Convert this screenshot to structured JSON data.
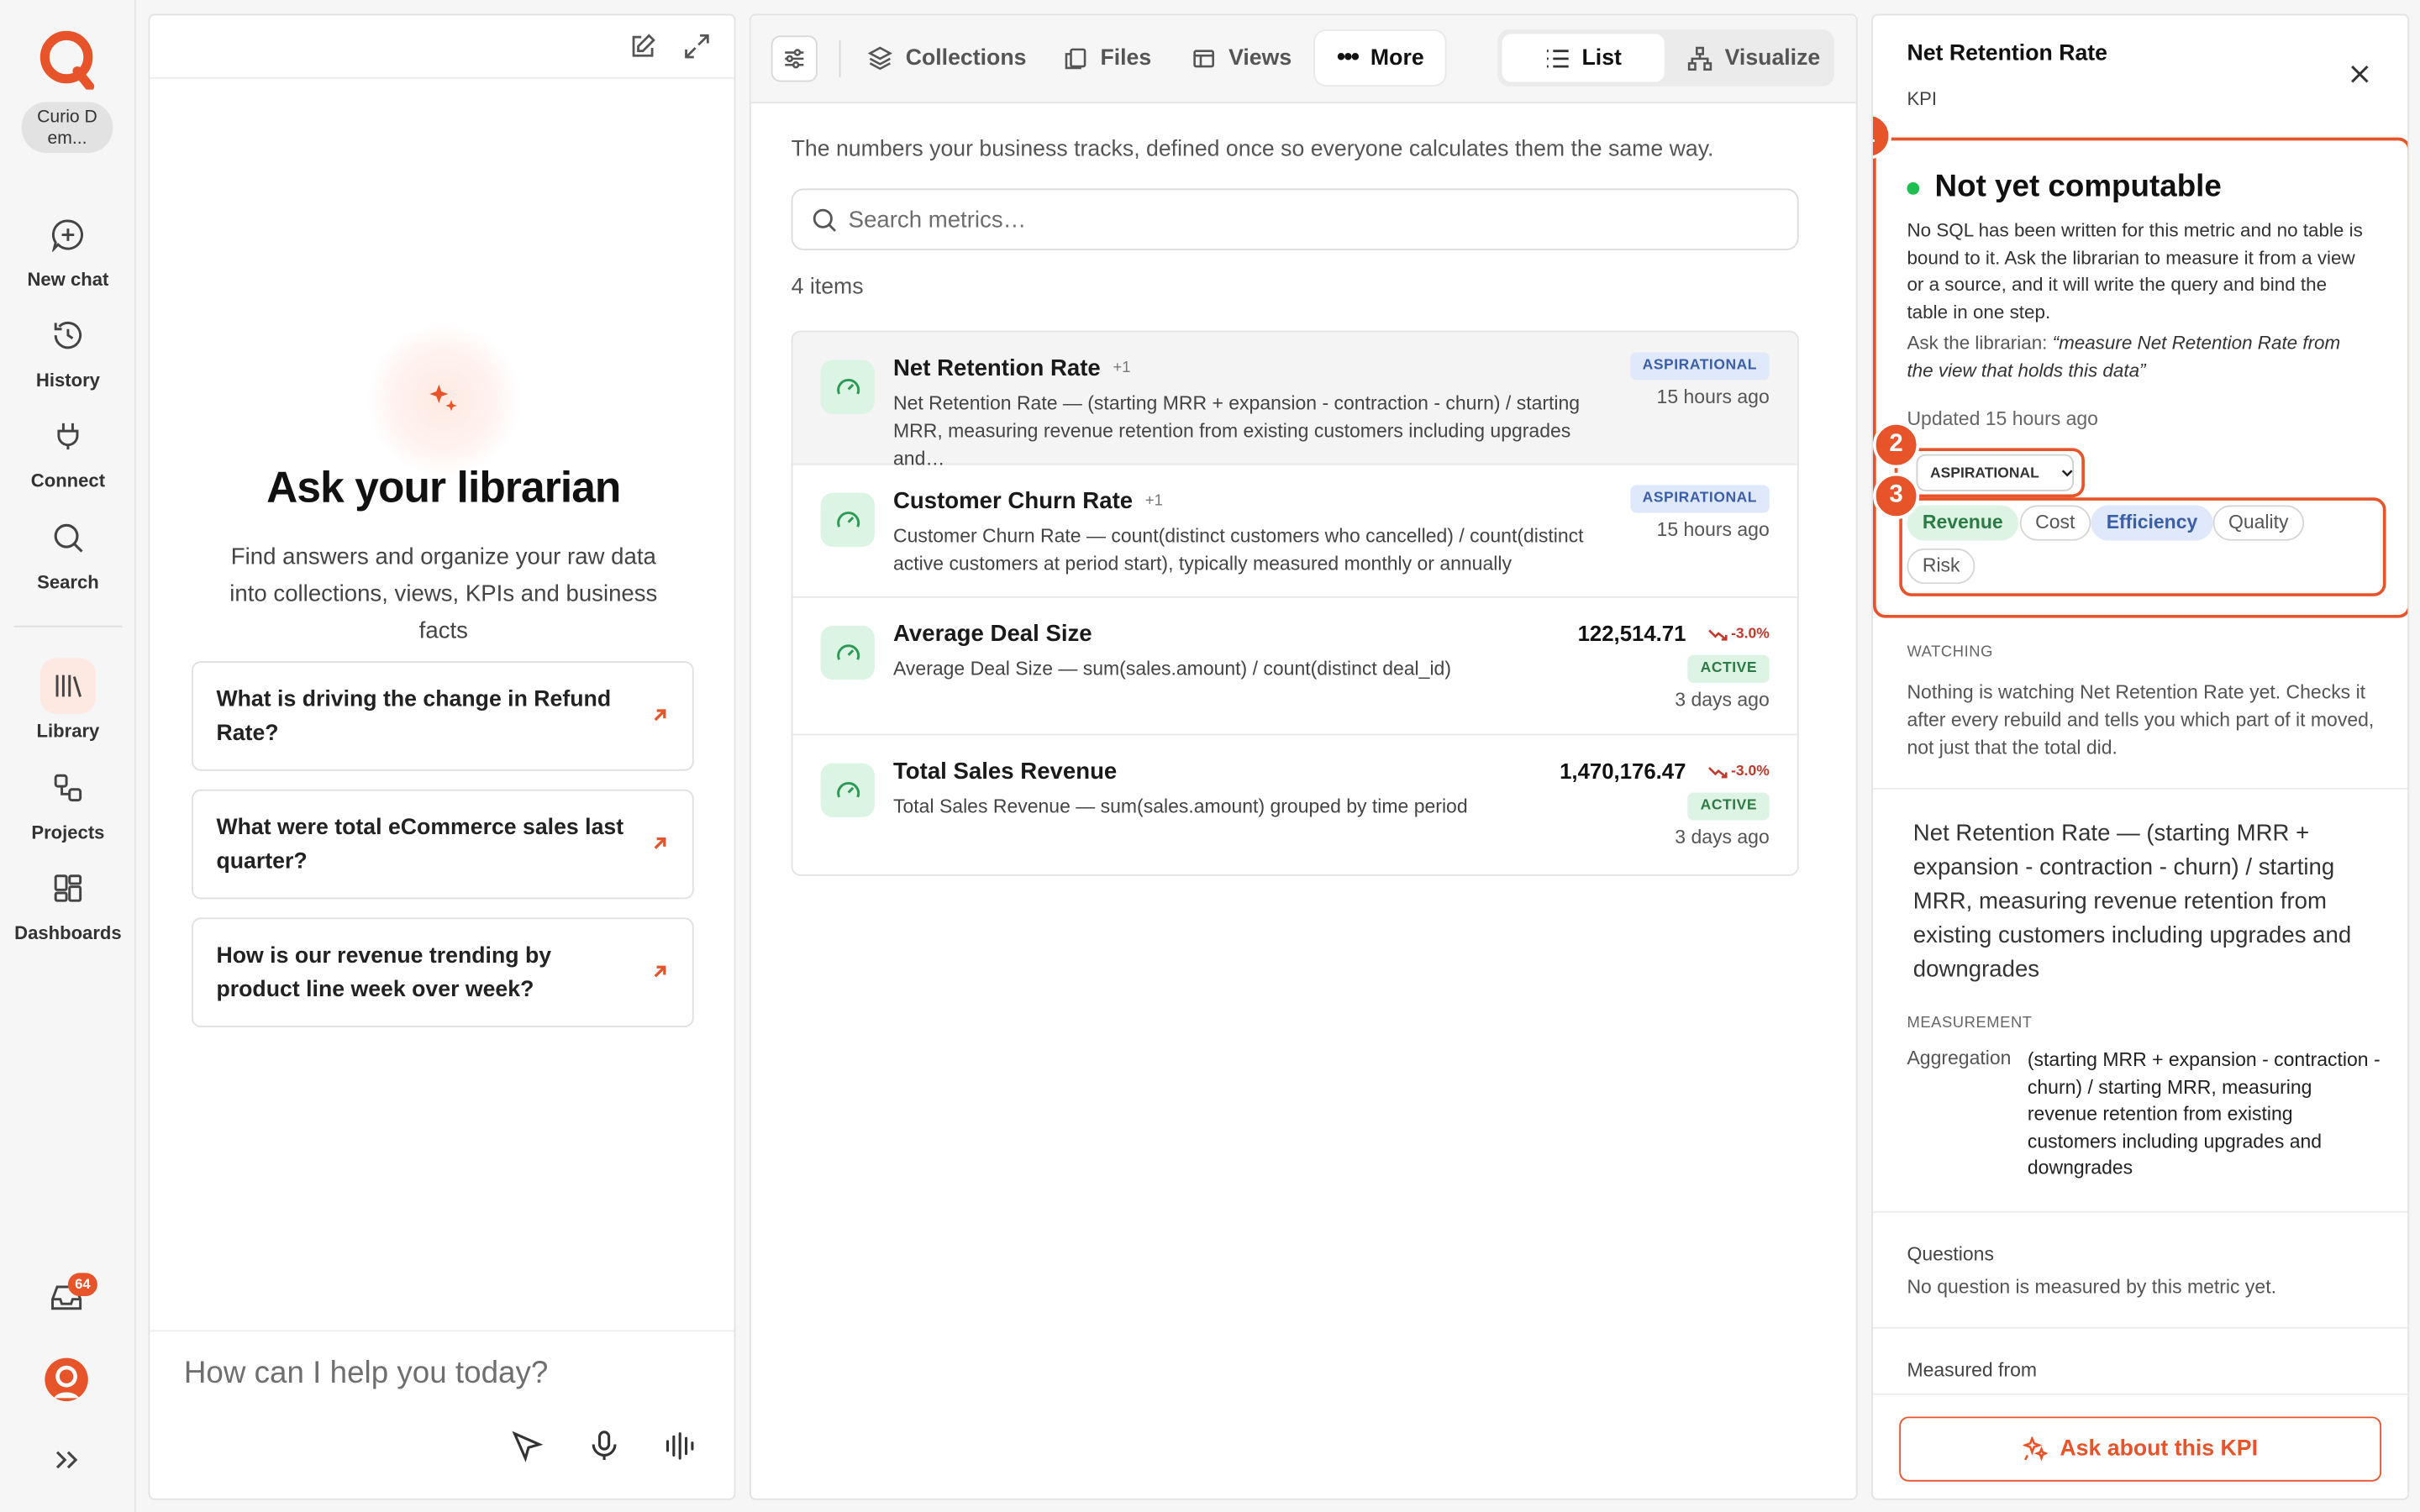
{
  "workspace": {
    "name": "Curio Dem..."
  },
  "rail": {
    "new_chat": "New chat",
    "history": "History",
    "connect": "Connect",
    "search": "Search",
    "library": "Library",
    "projects": "Projects",
    "dashboards": "Dashboards",
    "inbox_badge": "64"
  },
  "chat": {
    "title": "Ask your librarian",
    "subtitle": "Find answers and organize your raw data into collections, views, KPIs and business facts",
    "suggestions": [
      "What is driving the change in Refund Rate?",
      "What were total eCommerce sales last quarter?",
      "How is our revenue trending by product line week over week?"
    ],
    "input_placeholder": "How can I help you today?"
  },
  "toolbar": {
    "collections": "Collections",
    "files": "Files",
    "views": "Views",
    "more": "More",
    "list": "List",
    "visualize": "Visualize"
  },
  "main": {
    "lead": "The numbers your business tracks, defined once so everyone calculates them the same way.",
    "search_placeholder": "Search metrics…",
    "count": "4 items",
    "metrics": [
      {
        "name": "Net Retention Rate",
        "plus": "+1",
        "desc": "Net Retention Rate — (starting MRR + expansion - contraction - churn) / starting MRR, measuring revenue retention from existing customers including upgrades and…",
        "status": "ASPIRATIONAL",
        "ago": "15 hours ago"
      },
      {
        "name": "Customer Churn Rate",
        "plus": "+1",
        "desc": "Customer Churn Rate — count(distinct customers who cancelled) / count(distinct active customers at period start), typically measured monthly or annually",
        "status": "ASPIRATIONAL",
        "ago": "15 hours ago"
      },
      {
        "name": "Average Deal Size",
        "desc": "Average Deal Size — sum(sales.amount) / count(distinct deal_id)",
        "value": "122,514.71",
        "delta": "-3.0%",
        "status": "ACTIVE",
        "ago": "3 days ago"
      },
      {
        "name": "Total Sales Revenue",
        "desc": "Total Sales Revenue — sum(sales.amount) grouped by time period",
        "value": "1,470,176.47",
        "delta": "-3.0%",
        "status": "ACTIVE",
        "ago": "3 days ago"
      }
    ]
  },
  "detail": {
    "title": "Net Retention Rate",
    "subtitle": "KPI",
    "callouts": [
      "1",
      "2",
      "3"
    ],
    "status_title": "Not yet computable",
    "status_desc": "No SQL has been written for this metric and no table is bound to it. Ask the librarian to measure it from a view or a source, and it will write the query and bind the table in one step.",
    "hint_prefix": "Ask the librarian: ",
    "hint_quote": "“measure Net Retention Rate from the view that holds this data”",
    "updated": "Updated 15 hours ago",
    "status_select": "ASPIRATIONAL",
    "tags": [
      "Revenue",
      "Cost",
      "Efficiency",
      "Quality",
      "Risk"
    ],
    "watching_label": "WATCHING",
    "watching_text": "Nothing is watching Net Retention Rate yet. Checks it after every rebuild and tells you which part of it moved, not just that the total did.",
    "definition": "Net Retention Rate — (starting MRR + expansion - contraction - churn) / starting MRR, measuring revenue retention from existing customers including upgrades and downgrades",
    "measurement_label": "MEASUREMENT",
    "aggregation_label": "Aggregation",
    "aggregation_value": "(starting MRR + expansion - contraction - churn) / starting MRR, measuring revenue retention from existing customers including upgrades and downgrades",
    "questions_label": "Questions",
    "questions_text": "No question is measured by this metric yet.",
    "measured_from_label": "Measured from",
    "ask_button": "Ask about this KPI"
  },
  "colors": {
    "accent": "#e8542a",
    "active_green": "#2c7a44",
    "aspirational_blue": "#3b5ea8"
  }
}
